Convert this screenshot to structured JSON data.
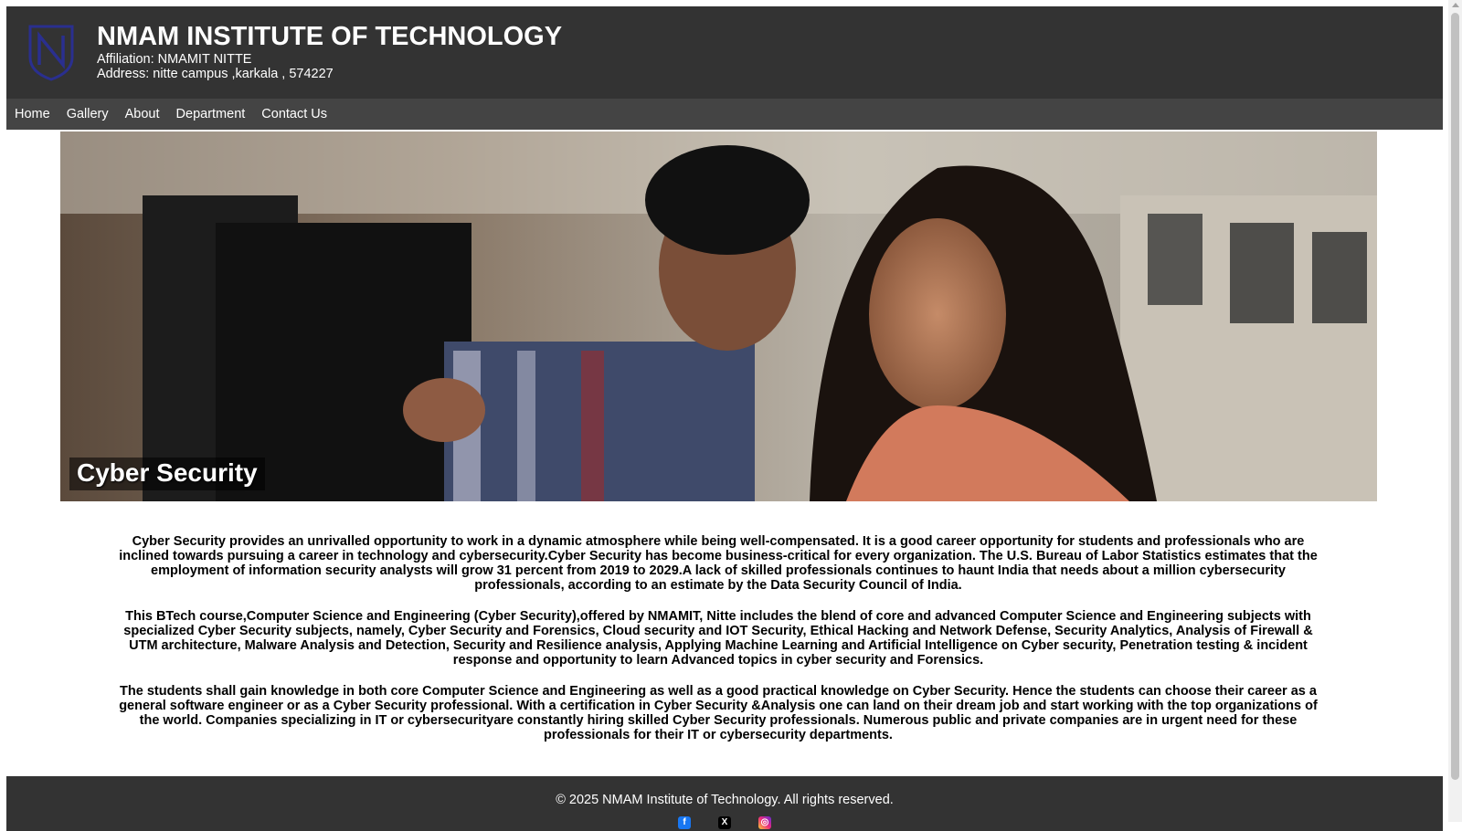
{
  "header": {
    "title": "NMAM INSTITUTE OF TECHNOLOGY",
    "affiliation": "Affiliation: NMAMIT NITTE",
    "address": "Address: nitte campus ,karkala , 574227",
    "logo_icon": "nmamit-shield-logo"
  },
  "nav": {
    "items": [
      {
        "label": "Home"
      },
      {
        "label": "Gallery"
      },
      {
        "label": "About"
      },
      {
        "label": "Department"
      },
      {
        "label": "Contact Us"
      }
    ]
  },
  "hero": {
    "caption": "Cyber Security"
  },
  "content": {
    "paragraphs": [
      "Cyber Security provides an unrivalled opportunity to work in a dynamic atmosphere while being well-compensated. It is a good career opportunity for students and professionals who are inclined towards pursuing a career in technology and cybersecurity.Cyber Security has become business-critical for every organization. The U.S. Bureau of Labor Statistics estimates that the employment of information security analysts will grow 31 percent from 2019 to 2029.A lack of skilled professionals continues to haunt India that needs about a million cybersecurity professionals, according to an estimate by the Data Security Council of India.",
      "This BTech course,Computer Science and Engineering (Cyber Security),offered by NMAMIT, Nitte includes the blend of core and advanced Computer Science and Engineering subjects with specialized Cyber Security subjects, namely, Cyber Security and Forensics, Cloud security and IOT Security, Ethical Hacking and Network Defense, Security Analytics, Analysis of Firewall & UTM architecture, Malware Analysis and Detection, Security and Resilience analysis, Applying Machine Learning and Artificial Intelligence on Cyber security, Penetration testing & incident response and opportunity to learn Advanced topics in cyber security and Forensics.",
      "The students shall gain knowledge in both core Computer Science and Engineering as well as a good practical knowledge on Cyber Security. Hence the students can choose their career as a general software engineer or as a Cyber Security professional. With a certification in Cyber Security &Analysis one can land on their dream job and start working with the top organizations of the world. Companies specializing in IT or cybersecurityare constantly hiring skilled Cyber Security professionals. Numerous public and private companies are in urgent need for these professionals for their IT or cybersecurity departments."
    ]
  },
  "footer": {
    "copyright": "© 2025 NMAM Institute of Technology. All rights reserved.",
    "social": [
      {
        "icon": "facebook-icon",
        "glyph": "f"
      },
      {
        "icon": "x-twitter-icon",
        "glyph": "X"
      },
      {
        "icon": "instagram-icon",
        "glyph": "◎"
      }
    ]
  },
  "colors": {
    "header_bg": "#333333",
    "nav_bg": "#444444",
    "footer_bg": "#333333",
    "logo_blue": "#2a2f8f"
  }
}
